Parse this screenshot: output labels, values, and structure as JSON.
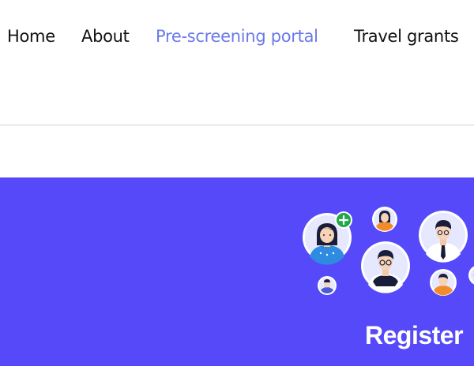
{
  "nav": {
    "items": [
      {
        "label": "Home"
      },
      {
        "label": "About"
      },
      {
        "label": "Pre-screening portal",
        "active": true
      },
      {
        "label": "Travel grants"
      }
    ]
  },
  "hero": {
    "register_label": "Register",
    "background_color": "#5549f9",
    "badge_symbol": "+",
    "badge_color": "#22a84a"
  },
  "colors": {
    "active_nav": "#6b79e8",
    "nav_text": "#111111",
    "divider": "#cfcfcf"
  }
}
